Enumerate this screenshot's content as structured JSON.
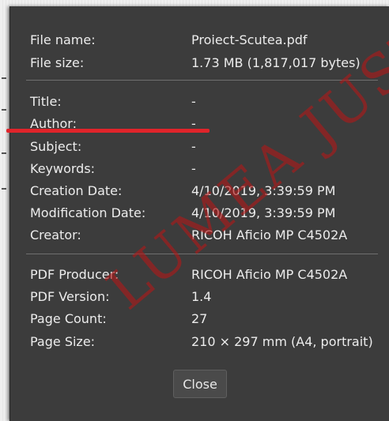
{
  "dialog": {
    "file_info": [
      {
        "label": "File name:",
        "value": "Proiect-Scutea.pdf"
      },
      {
        "label": "File size:",
        "value": "1.73 MB (1,817,017 bytes)"
      }
    ],
    "document_info": [
      {
        "label": "Title:",
        "value": "-"
      },
      {
        "label": "Author:",
        "value": "-"
      },
      {
        "label": "Subject:",
        "value": "-"
      },
      {
        "label": "Keywords:",
        "value": "-"
      },
      {
        "label": "Creation Date:",
        "value": "4/10/2019, 3:39:59 PM"
      },
      {
        "label": "Modification Date:",
        "value": "4/10/2019, 3:39:59 PM"
      },
      {
        "label": "Creator:",
        "value": "RICOH Aficio MP C4502A"
      }
    ],
    "pdf_info": [
      {
        "label": "PDF Producer:",
        "value": "RICOH Aficio MP C4502A"
      },
      {
        "label": "PDF Version:",
        "value": "1.4"
      },
      {
        "label": "Page Count:",
        "value": "27"
      },
      {
        "label": "Page Size:",
        "value": "210 × 297 mm (A4, portrait)"
      }
    ],
    "close_label": "Close"
  },
  "overlay": {
    "underline_color": "#e0242a",
    "watermark_color": "#b01a1a",
    "watermark_text": "LUMEA JUSTITIEI"
  }
}
